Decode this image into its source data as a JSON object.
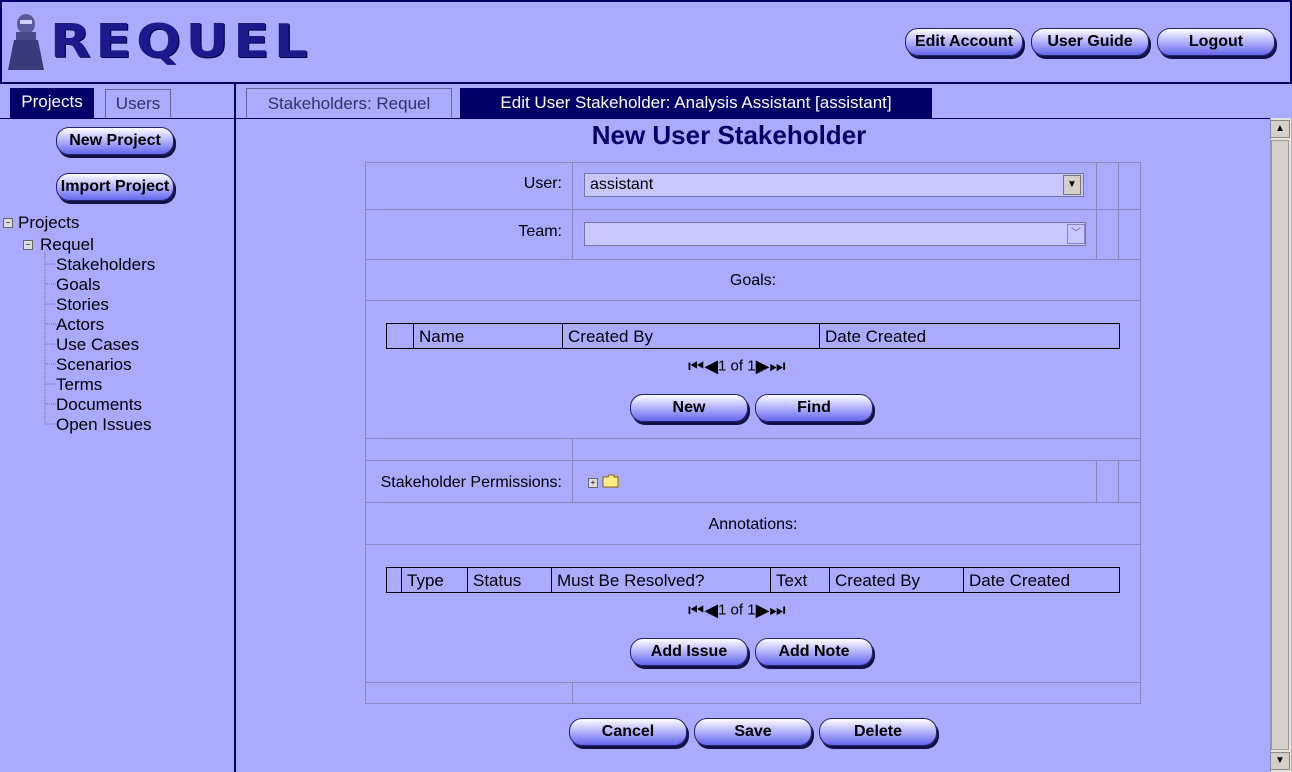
{
  "header": {
    "logo_text": "REQUEL",
    "buttons": {
      "edit_account": "Edit Account",
      "user_guide": "User Guide",
      "logout": "Logout"
    }
  },
  "nav": {
    "tabs": {
      "projects": "Projects",
      "users": "Users"
    },
    "buttons": {
      "new_project": "New Project",
      "import_project": "Import Project"
    },
    "tree": {
      "root": "Projects",
      "project": "Requel",
      "items": [
        "Stakeholders",
        "Goals",
        "Stories",
        "Actors",
        "Use Cases",
        "Scenarios",
        "Terms",
        "Documents",
        "Open Issues"
      ]
    }
  },
  "main": {
    "tabs": {
      "stakeholders": "Stakeholders: Requel",
      "edit": "Edit User Stakeholder: Analysis Assistant [assistant]"
    },
    "title": "New User Stakeholder",
    "form": {
      "user_label": "User:",
      "user_value": "assistant",
      "team_label": "Team:",
      "team_value": "",
      "goals_label": "Goals:",
      "goals_columns": [
        "Name",
        "Created By",
        "Date Created"
      ],
      "goals_pager": "1 of 1",
      "goals_buttons": {
        "new": "New",
        "find": "Find"
      },
      "permissions_label": "Stakeholder Permissions:",
      "annotations_label": "Annotations:",
      "annotations_columns": [
        "Type",
        "Status",
        "Must Be Resolved?",
        "Text",
        "Created By",
        "Date Created"
      ],
      "annotations_pager": "1 of 1",
      "annotations_buttons": {
        "add_issue": "Add Issue",
        "add_note": "Add Note"
      }
    },
    "actions": {
      "cancel": "Cancel",
      "save": "Save",
      "delete": "Delete"
    }
  },
  "colors": {
    "background": "#aaaaff",
    "dark_tab": "#000066",
    "title": "#000066"
  }
}
